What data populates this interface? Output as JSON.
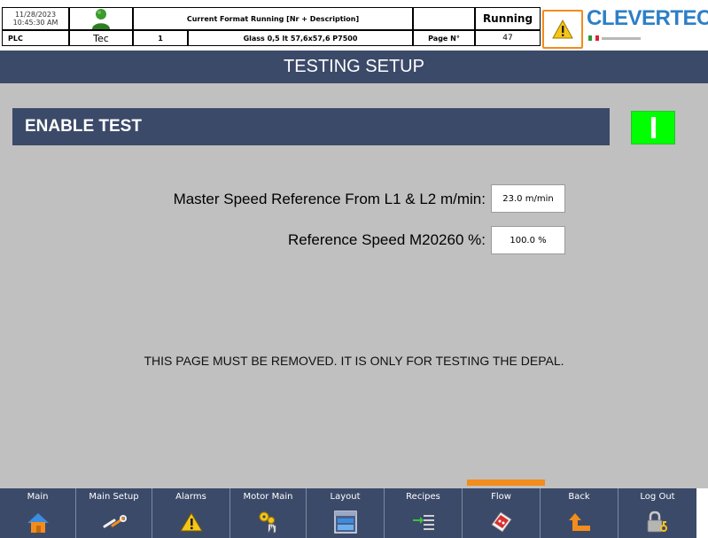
{
  "header": {
    "date": "11/28/2023",
    "time": "10:45:30 AM",
    "source": "PLC",
    "user_name": "Tec",
    "format_title": "Current Format Running [Nr + Description]",
    "format_number": "1",
    "format_description": "Glass 0,5 lt 57,6x57,6  P7500",
    "page_label": "Page N°",
    "page_number": "47",
    "machine_status": "Running",
    "brand": "CLEVERTECH",
    "colors": {
      "accent": "#3c4a69",
      "alarm_border": "#f28c1c",
      "brand": "#2d7fc6"
    }
  },
  "screen": {
    "title": "TESTING SETUP"
  },
  "content": {
    "enable_label": "ENABLE TEST",
    "enable_state": "on",
    "enable_color": "#00ff00",
    "params": [
      {
        "label": "Master Speed Reference From L1 & L2 m/min:",
        "value": "23.0 m/min"
      },
      {
        "label": "Reference Speed M20260 %:",
        "value": "100.0 %"
      }
    ],
    "notice": "THIS PAGE MUST BE REMOVED. IT IS ONLY FOR TESTING THE DEPAL."
  },
  "nav": {
    "active": "Flow",
    "items": [
      {
        "label": "Main",
        "icon": "home-icon"
      },
      {
        "label": "Main Setup",
        "icon": "wrench-icon"
      },
      {
        "label": "Alarms",
        "icon": "warning-icon"
      },
      {
        "label": "Motor Main",
        "icon": "gears-hand-icon"
      },
      {
        "label": "Layout",
        "icon": "layout-window-icon"
      },
      {
        "label": "Recipes",
        "icon": "recipe-list-icon"
      },
      {
        "label": "Flow",
        "icon": "flow-icon"
      },
      {
        "label": "Back",
        "icon": "back-arrow-icon"
      },
      {
        "label": "Log Out",
        "icon": "lock-key-icon"
      }
    ]
  }
}
